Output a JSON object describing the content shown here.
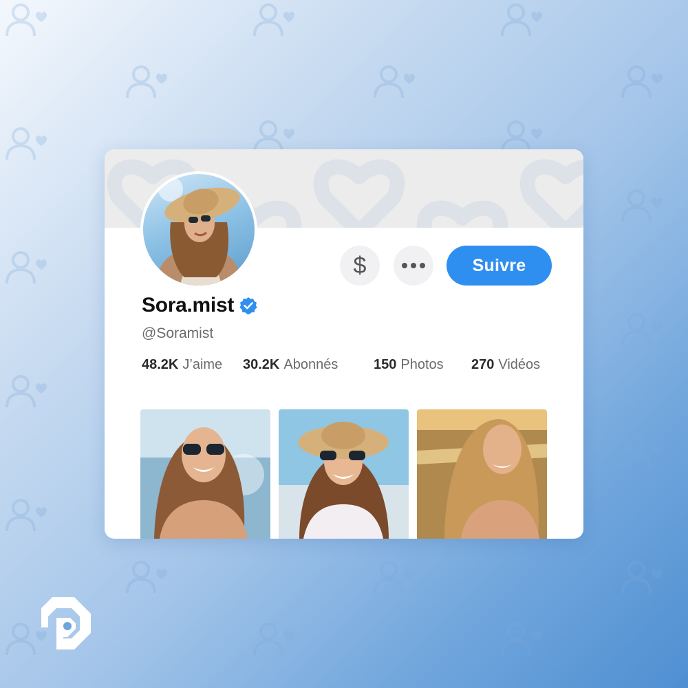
{
  "profile": {
    "name": "Sora.mist",
    "handle": "@Soramist",
    "verified": true
  },
  "actions": {
    "tip_icon": "$",
    "more_icon": "more-horizontal-icon",
    "follow_label": "Suivre"
  },
  "stats": [
    {
      "value": "48.2K",
      "label": "J’aime"
    },
    {
      "value": "30.2K",
      "label": "Abonnés"
    },
    {
      "value": "150",
      "label": "Photos"
    },
    {
      "value": "270",
      "label": "Vidéos"
    }
  ],
  "gallery": [
    {
      "icon": "beach-photo-sunglasses"
    },
    {
      "icon": "beach-photo-straw-hat"
    },
    {
      "icon": "beach-photo-sunset"
    }
  ],
  "colors": {
    "accent": "#2f8ff0",
    "verified": "#2f8ff0",
    "background_start": "#f4f8fd",
    "background_end": "#4f8fd2"
  }
}
